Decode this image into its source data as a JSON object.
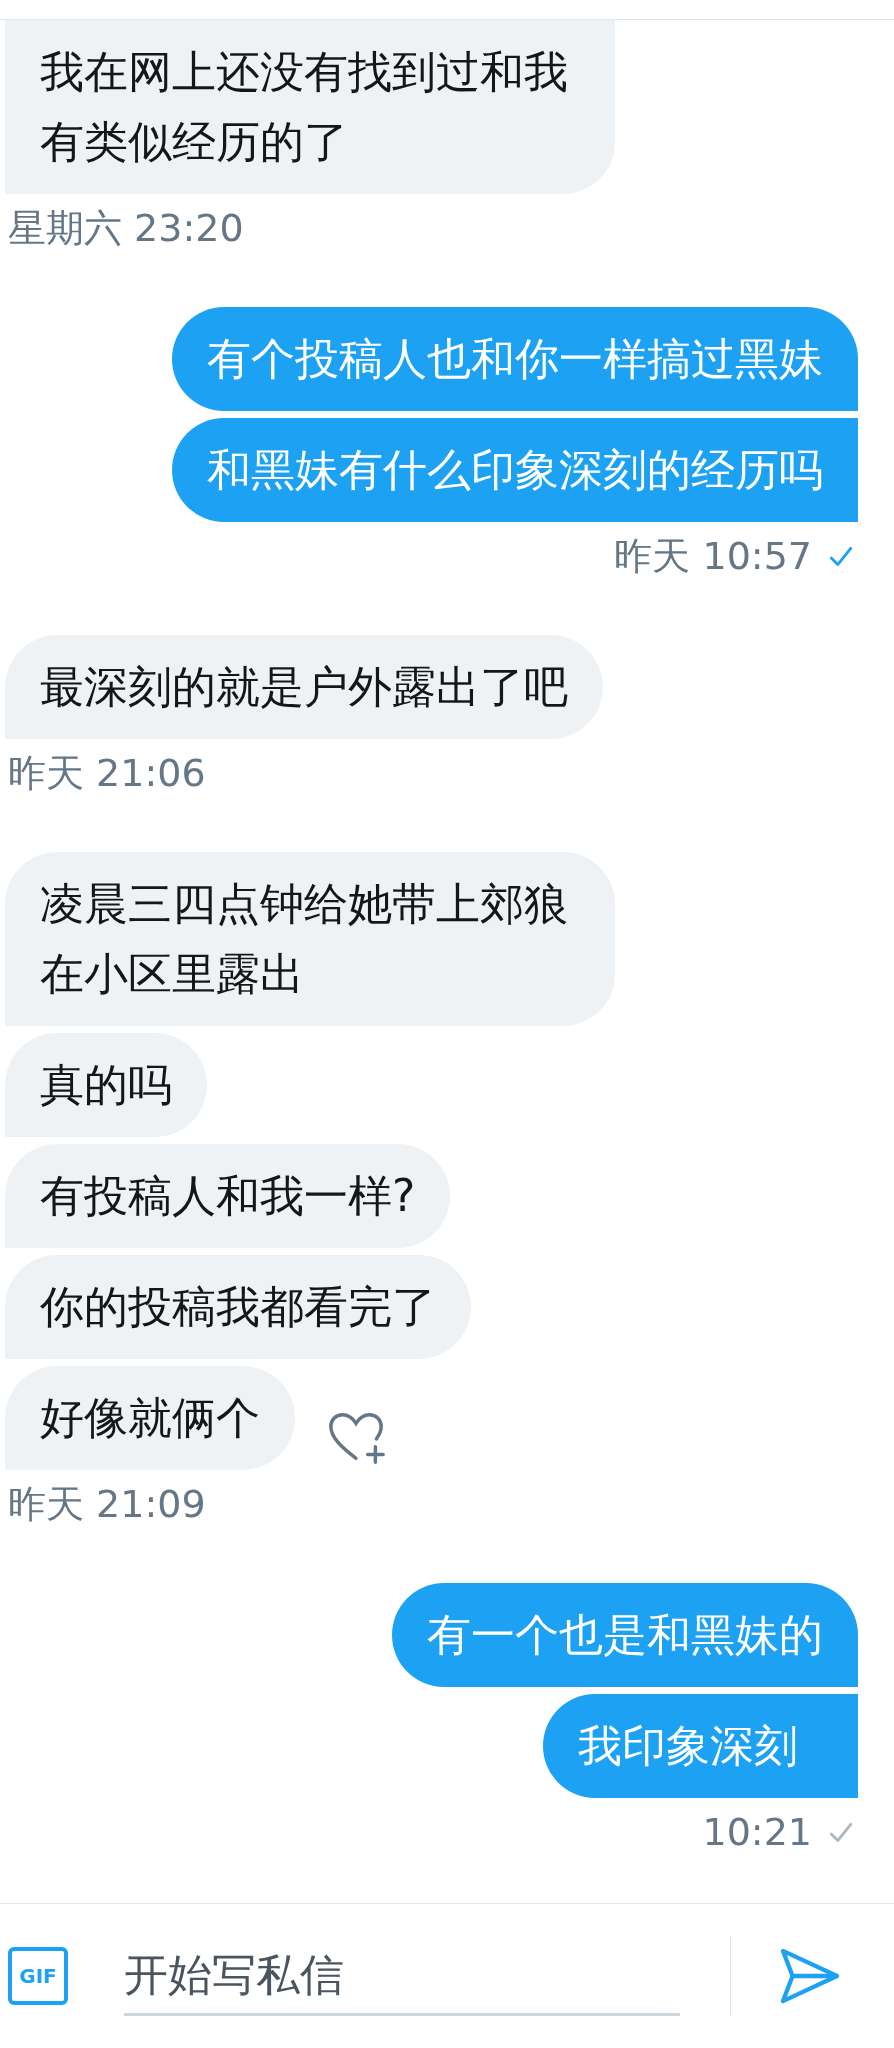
{
  "groups": [
    {
      "kind": "received",
      "messages": [
        "我在网上还没有找到过和我有类似经历的了"
      ],
      "time": "星期六 23:20"
    },
    {
      "kind": "sent",
      "messages": [
        "有个投稿人也和你一样搞过黑妹",
        "和黑妹有什么印象深刻的经历吗"
      ],
      "time": "昨天 10:57",
      "read": true
    },
    {
      "kind": "received",
      "messages": [
        "最深刻的就是户外露出了吧"
      ],
      "time": "昨天 21:06"
    },
    {
      "kind": "received",
      "messages": [
        "凌晨三四点钟给她带上郊狼在小区里露出",
        "真的吗",
        "有投稿人和我一样?",
        "你的投稿我都看完了",
        "好像就俩个"
      ],
      "time": "昨天 21:09",
      "show_like": true
    },
    {
      "kind": "sent",
      "messages": [
        "有一个也是和黑妹的",
        "我印象深刻"
      ],
      "time": "10:21",
      "read": false
    }
  ],
  "composer": {
    "gif_label": "GIF",
    "placeholder": "开始写私信"
  }
}
